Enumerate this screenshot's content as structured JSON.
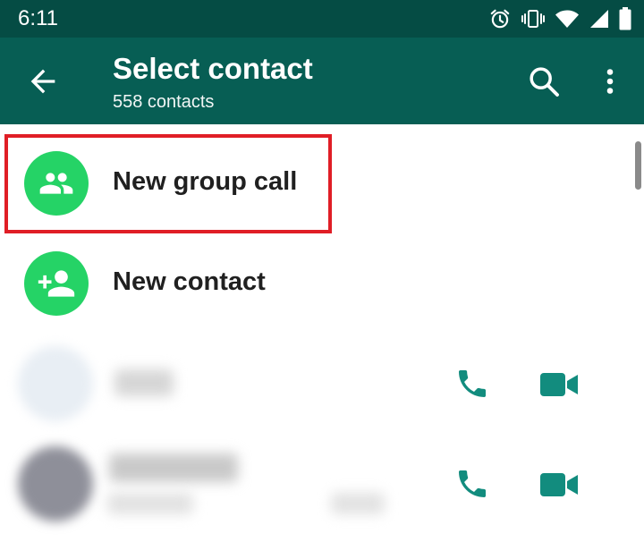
{
  "status_bar": {
    "time": "6:11"
  },
  "app_bar": {
    "title": "Select contact",
    "subtitle": "558 contacts"
  },
  "actions": [
    {
      "label": "New group call"
    },
    {
      "label": "New contact"
    }
  ],
  "colors": {
    "status_bar": "#054c44",
    "app_bar": "#075e54",
    "accent_green": "#25d366",
    "teal_icon": "#128c7e",
    "highlight_border": "#e01e26"
  }
}
